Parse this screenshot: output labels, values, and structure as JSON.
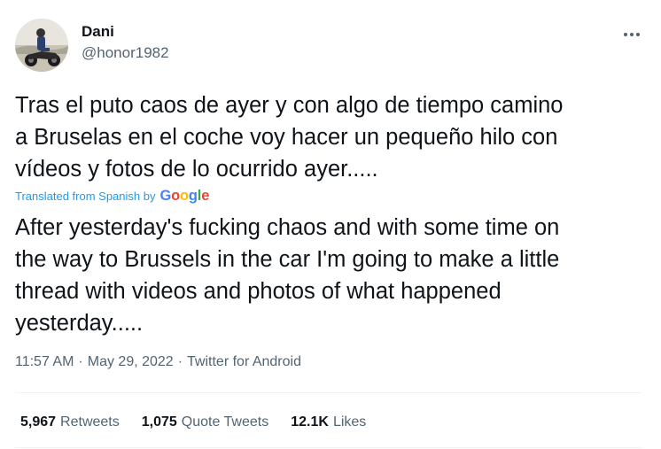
{
  "colors": {
    "text": "#0f1419",
    "secondary": "#536471",
    "accent": "#1d9bf0",
    "divider": "#eff3f4"
  },
  "author": {
    "display_name": "Dani",
    "handle": "@honor1982",
    "avatar_icon": "avatar-motorcycle-photo"
  },
  "more_icon": "more-options-icon",
  "tweet": {
    "original_lines": [
      "Tras el puto caos de ayer y con algo de tiempo camino",
      "a Bruselas en el coche voy hacer un pequeño hilo con",
      "vídeos y fotos de lo ocurrido ayer....."
    ],
    "translation_label": "Translated from Spanish by",
    "translation_provider": {
      "letters": [
        "G",
        "o",
        "o",
        "g",
        "l",
        "e"
      ],
      "colors": [
        "blue",
        "red",
        "yellow",
        "blue",
        "green",
        "red"
      ]
    },
    "translated_lines": [
      "After yesterday's fucking chaos and with some time on",
      "the way to Brussels in the car I'm going to make a little",
      "thread with videos and photos of what happened",
      "yesterday....."
    ]
  },
  "meta": {
    "time": "11:57 AM",
    "separator": "·",
    "date": "May 29, 2022",
    "source": "Twitter for Android"
  },
  "stats": {
    "retweets": {
      "count": "5,967",
      "label": "Retweets"
    },
    "quote_tweets": {
      "count": "1,075",
      "label": "Quote Tweets"
    },
    "likes": {
      "count": "12.1K",
      "label": "Likes"
    }
  }
}
